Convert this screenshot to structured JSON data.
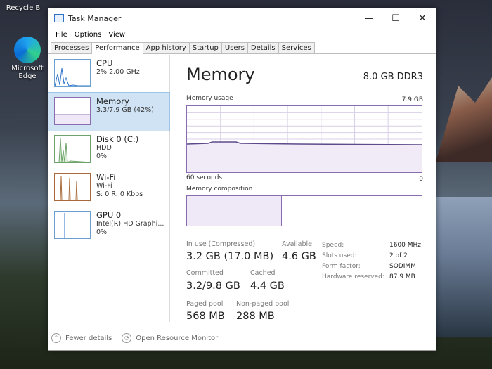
{
  "desktop": {
    "recycle_label": "Recycle B",
    "edge_label": "Microsoft Edge"
  },
  "window": {
    "title": "Task Manager",
    "controls": {
      "minimize": "—",
      "maximize": "☐",
      "close": "✕"
    }
  },
  "menu": [
    "File",
    "Options",
    "View"
  ],
  "tabs": [
    "Processes",
    "Performance",
    "App history",
    "Startup",
    "Users",
    "Details",
    "Services"
  ],
  "active_tab": "Performance",
  "resources": [
    {
      "name": "CPU",
      "line1": "2% 2.00 GHz",
      "line2": ""
    },
    {
      "name": "Memory",
      "line1": "3.3/7.9 GB (42%)",
      "line2": ""
    },
    {
      "name": "Disk 0 (C:)",
      "line1": "HDD",
      "line2": "0%"
    },
    {
      "name": "Wi-Fi",
      "line1": "Wi-Fi",
      "line2": "S: 0 R: 0 Kbps"
    },
    {
      "name": "GPU 0",
      "line1": "Intel(R) HD Graphi...",
      "line2": "0%"
    }
  ],
  "selected_resource": "Memory",
  "memory": {
    "title": "Memory",
    "spec": "8.0 GB DDR3",
    "usage_label": "Memory usage",
    "usage_max": "7.9 GB",
    "time_label": "60 seconds",
    "time_end": "0",
    "composition_label": "Memory composition",
    "composition_in_use_fraction": 0.4,
    "stats": {
      "in_use_label": "In use (Compressed)",
      "in_use_value": "3.2 GB (17.0 MB)",
      "available_label": "Available",
      "available_value": "4.6 GB",
      "committed_label": "Committed",
      "committed_value": "3.2/9.8 GB",
      "cached_label": "Cached",
      "cached_value": "4.4 GB",
      "paged_label": "Paged pool",
      "paged_value": "568 MB",
      "nonpaged_label": "Non-paged pool",
      "nonpaged_value": "288 MB"
    },
    "details": {
      "speed_label": "Speed:",
      "speed_value": "1600 MHz",
      "slots_label": "Slots used:",
      "slots_value": "2 of 2",
      "form_label": "Form factor:",
      "form_value": "SODIMM",
      "reserved_label": "Hardware reserved:",
      "reserved_value": "87.9 MB"
    }
  },
  "footer": {
    "fewer": "Fewer details",
    "monitor": "Open Resource Monitor"
  },
  "colors": {
    "memory": "#8a6cb0",
    "cpu": "#2c73c9",
    "disk": "#6ea26b",
    "wifi": "#a86a3a"
  }
}
